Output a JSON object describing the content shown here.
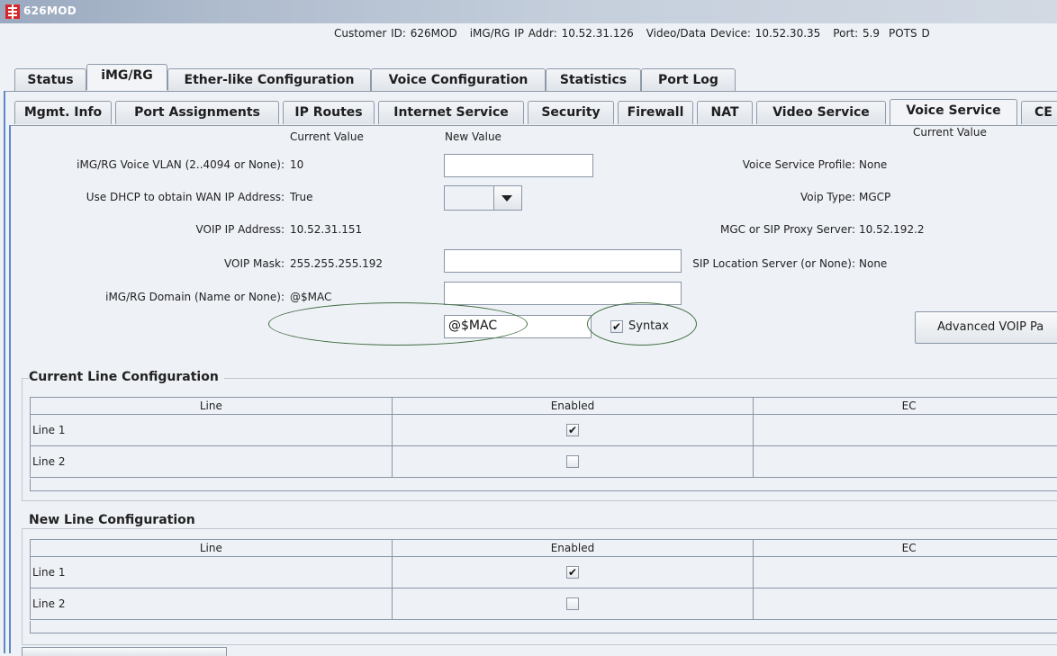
{
  "window": {
    "title": "626MOD"
  },
  "info": {
    "customer_id": "Customer ID: 626MOD",
    "img_ip": "iMG/RG IP Addr: 10.52.31.126",
    "video_device": "Video/Data Device: 10.52.30.35",
    "port": "Port: 5.9",
    "pots": "POTS D"
  },
  "tabs_top": [
    "Status",
    "iMG/RG",
    "Ether-like Configuration",
    "Voice Configuration",
    "Statistics",
    "Port Log"
  ],
  "tabs_top_selected": "iMG/RG",
  "tabs_sub": [
    "Mgmt. Info",
    "Port Assignments",
    "IP Routes",
    "Internet Service",
    "Security",
    "Firewall",
    "NAT",
    "Video Service",
    "Voice Service",
    "CE"
  ],
  "tabs_sub_selected": "Voice Service",
  "form": {
    "current_value_header": "Current Value",
    "new_value_header": "New Value",
    "right_current_value_header": "Current Value",
    "fields": [
      {
        "label": "iMG/RG Voice VLAN (2..4094 or None):",
        "current": "10",
        "new": ""
      },
      {
        "label": "Use DHCP to obtain WAN IP Address:",
        "current": "True",
        "new": ""
      },
      {
        "label": "VOIP IP Address:",
        "current": "10.52.31.151",
        "new": ""
      },
      {
        "label": "VOIP Mask:",
        "current": "255.255.255.192",
        "new": ""
      },
      {
        "label": "iMG/RG Domain (Name or None):",
        "current": "@$MAC",
        "new": "@$MAC"
      }
    ],
    "syntax_label": "Syntax",
    "syntax_checked": true,
    "right_fields": [
      {
        "label": "Voice Service Profile:",
        "value": "None"
      },
      {
        "label": "Voip Type:",
        "value": "MGCP"
      },
      {
        "label": "MGC or SIP Proxy Server:",
        "value": "10.52.192.2"
      },
      {
        "label": "SIP Location Server (or None):",
        "value": "None"
      }
    ],
    "advanced_button": "Advanced VOIP Pa"
  },
  "current_lines": {
    "title": "Current Line Configuration",
    "columns": [
      "Line",
      "Enabled",
      "EC"
    ],
    "rows": [
      {
        "line": "Line 1",
        "enabled": true
      },
      {
        "line": "Line 2",
        "enabled": false
      }
    ]
  },
  "new_lines": {
    "title": "New Line Configuration",
    "columns": [
      "Line",
      "Enabled",
      "EC"
    ],
    "rows": [
      {
        "line": "Line 1",
        "enabled": true
      },
      {
        "line": "Line 2",
        "enabled": false
      }
    ]
  },
  "colors": {
    "accent_blue": "#5f88c9",
    "annotation_green": "#3f6b3f",
    "app_icon_red": "#d6262b"
  }
}
